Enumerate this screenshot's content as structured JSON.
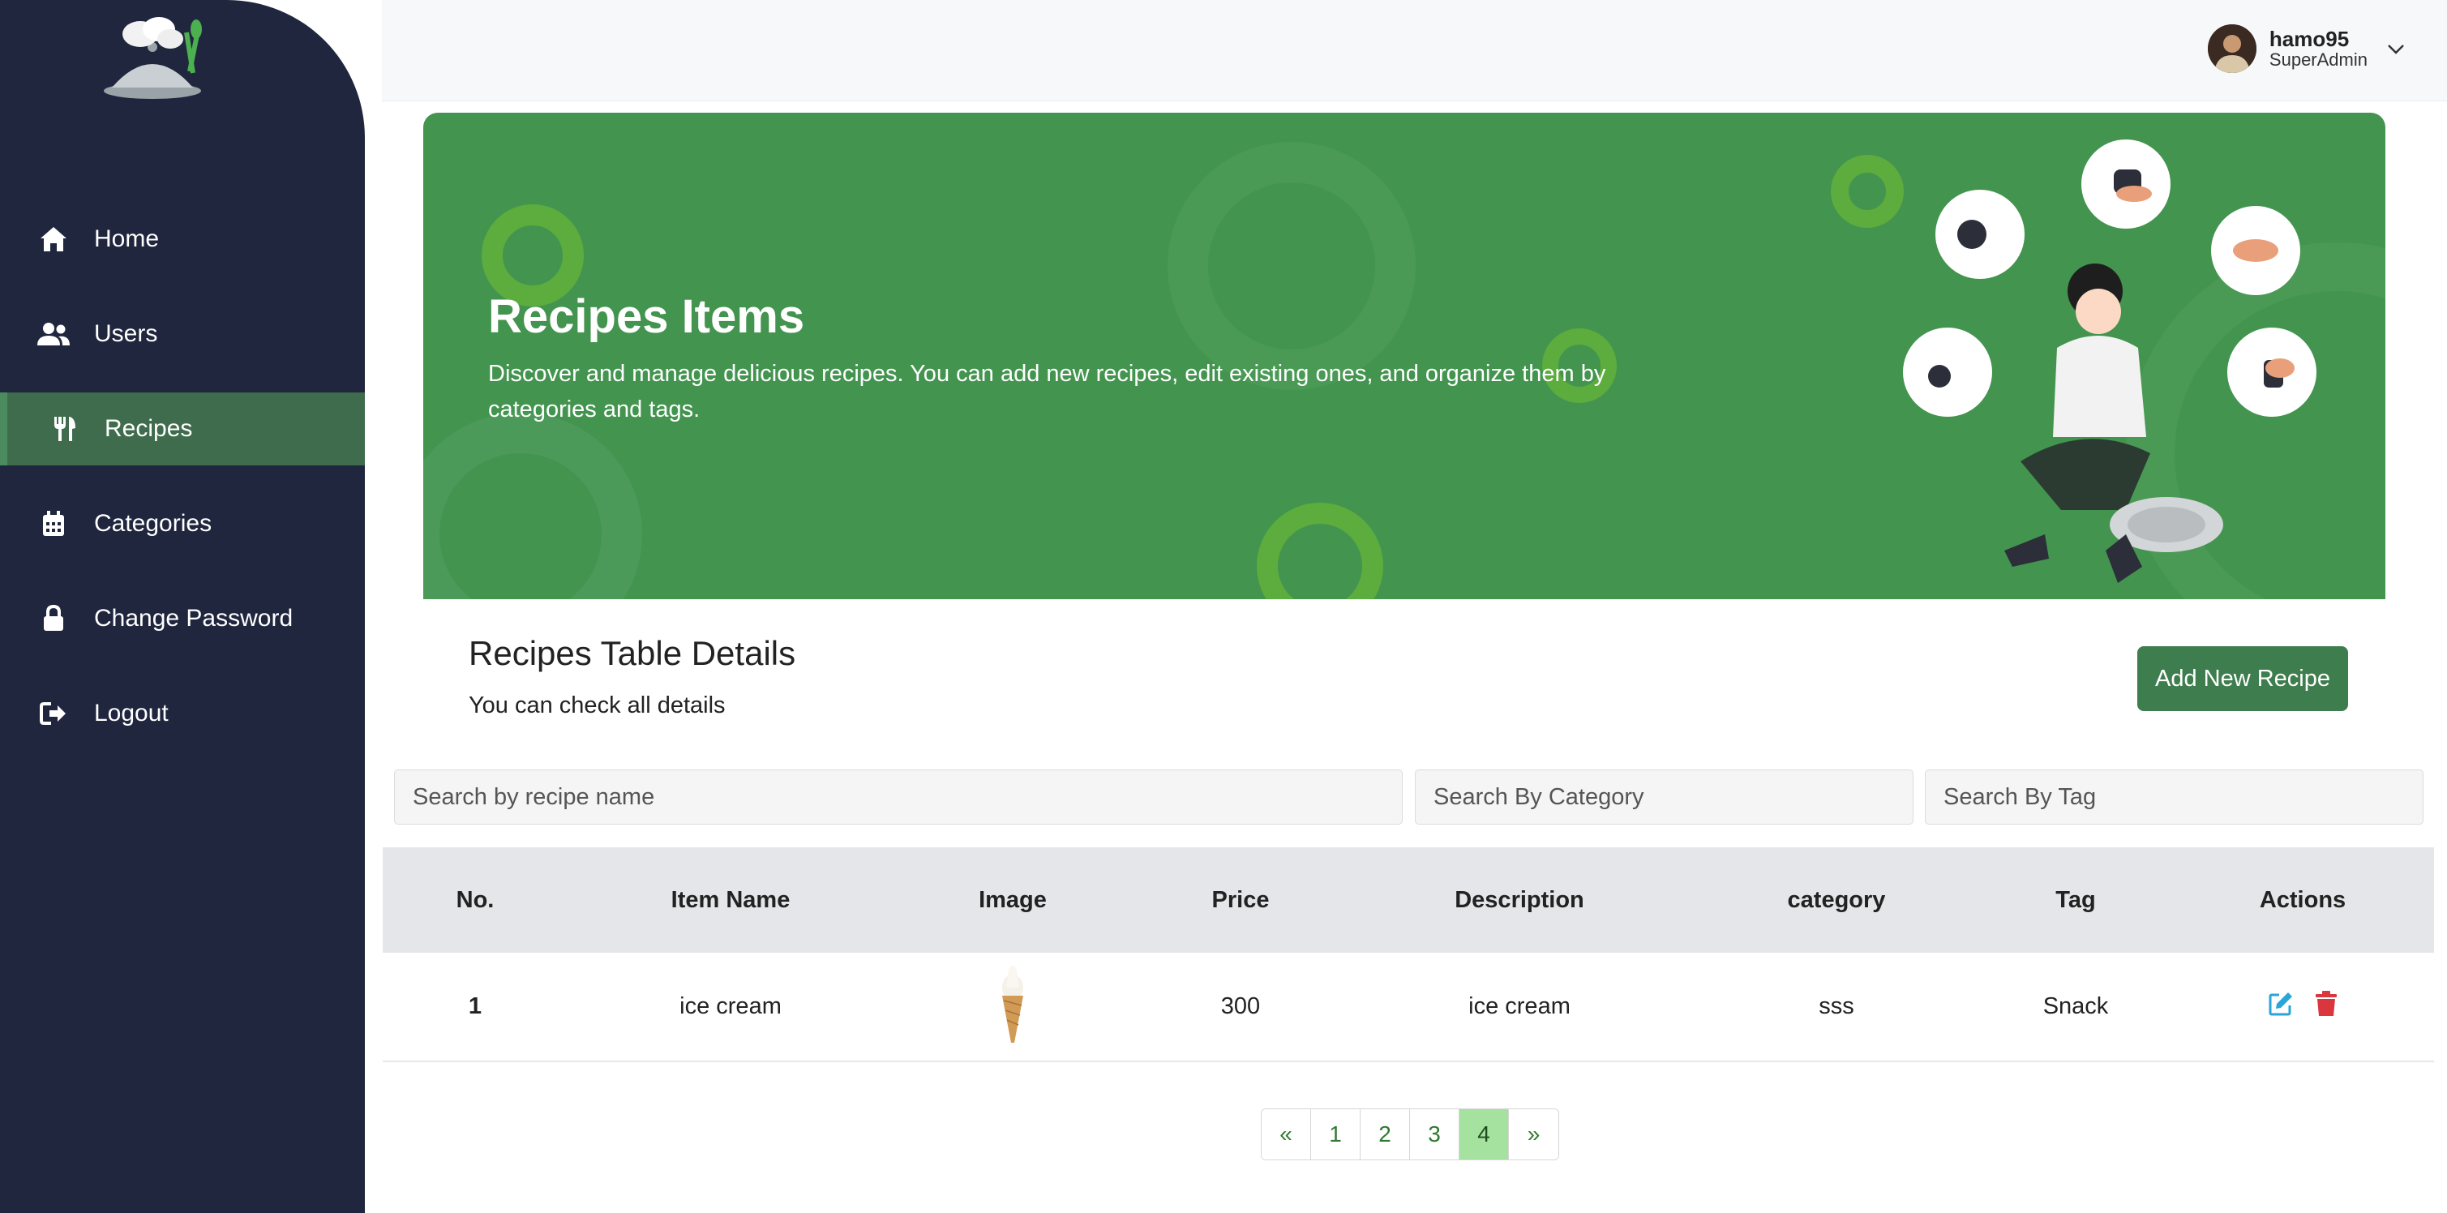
{
  "sidebar": {
    "items": [
      {
        "label": "Home",
        "icon": "home-icon"
      },
      {
        "label": "Users",
        "icon": "users-icon"
      },
      {
        "label": "Recipes",
        "icon": "utensils-icon",
        "active": true
      },
      {
        "label": "Categories",
        "icon": "calendar-icon"
      },
      {
        "label": "Change Password",
        "icon": "lock-icon"
      },
      {
        "label": "Logout",
        "icon": "logout-icon"
      }
    ]
  },
  "user": {
    "name": "hamo95",
    "role": "SuperAdmin"
  },
  "banner": {
    "title": "Recipes Items",
    "description": "Discover and manage delicious recipes. You can add new recipes, edit existing ones, and organize them by categories and tags."
  },
  "details": {
    "title": "Recipes Table Details",
    "subtitle": "You can check all details",
    "add_button": "Add New Recipe"
  },
  "search": {
    "name_placeholder": "Search by recipe name",
    "category_placeholder": "Search By Category",
    "tag_placeholder": "Search By Tag"
  },
  "table": {
    "headers": [
      "No.",
      "Item Name",
      "Image",
      "Price",
      "Description",
      "category",
      "Tag",
      "Actions"
    ],
    "rows": [
      {
        "no": "1",
        "name": "ice cream",
        "price": "300",
        "description": "ice cream",
        "category": "sss",
        "tag": "Snack"
      }
    ]
  },
  "pagination": {
    "prev": "«",
    "pages": [
      "1",
      "2",
      "3",
      "4"
    ],
    "active": "4",
    "next": "»"
  },
  "colors": {
    "sidebar_bg": "#1f263e",
    "accent_green": "#43944f",
    "button_green": "#3e7d4d",
    "edit_icon": "#2aa6d6",
    "delete_icon": "#d9363e"
  }
}
